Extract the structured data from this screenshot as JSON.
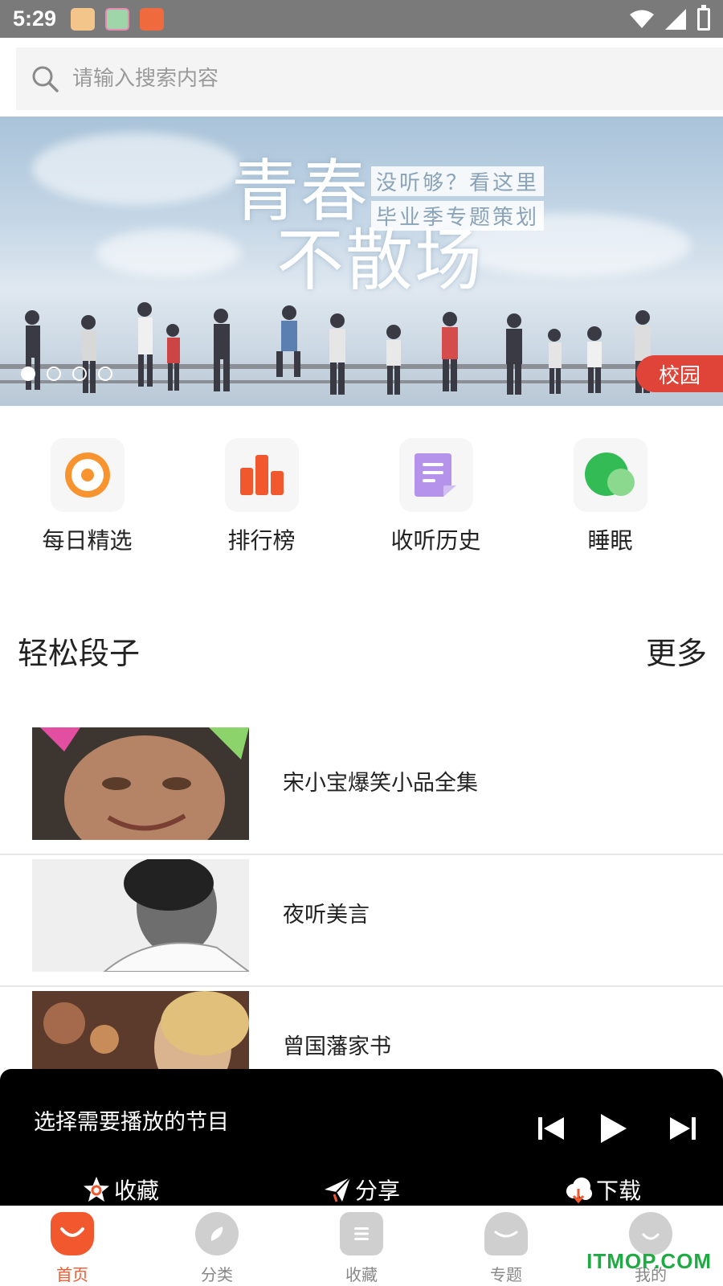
{
  "status_bar": {
    "time": "5:29"
  },
  "search": {
    "placeholder": "请输入搜索内容"
  },
  "banner": {
    "headline_line1": "青春",
    "headline_line2": "不散场",
    "subtag_line1": "没听够？看这里",
    "subtag_line2": "毕业季专题策划",
    "tag": "校园",
    "page_count": 4,
    "active_index": 0
  },
  "quick_nav": [
    {
      "label": "每日精选",
      "icon": "target-icon",
      "color": "#f7942f"
    },
    {
      "label": "排行榜",
      "icon": "ranking-bars-icon",
      "color": "#f2582e"
    },
    {
      "label": "收听历史",
      "icon": "document-icon",
      "color": "#b693ea"
    },
    {
      "label": "睡眠",
      "icon": "moon-circles-icon",
      "color": "#33bb55"
    }
  ],
  "section": {
    "title": "轻松段子",
    "more": "更多"
  },
  "list": [
    {
      "title": "宋小宝爆笑小品全集"
    },
    {
      "title": "夜听美言"
    },
    {
      "title": "曾国藩家书"
    }
  ],
  "player": {
    "now_playing": "选择需要播放的节目",
    "favorite_label": "收藏",
    "share_label": "分享",
    "download_label": "下载"
  },
  "tabs": [
    {
      "label": "首页",
      "icon": "home-icon",
      "active": true
    },
    {
      "label": "分类",
      "icon": "compass-icon",
      "active": false
    },
    {
      "label": "收藏",
      "icon": "list-icon",
      "active": false
    },
    {
      "label": "专题",
      "icon": "topic-icon",
      "active": false
    },
    {
      "label": "我的",
      "icon": "profile-icon",
      "active": false
    }
  ],
  "watermark": "ITMOP.COM",
  "colors": {
    "accent": "#f2582e",
    "tag_red": "#e04439",
    "player_bg": "#000000"
  }
}
